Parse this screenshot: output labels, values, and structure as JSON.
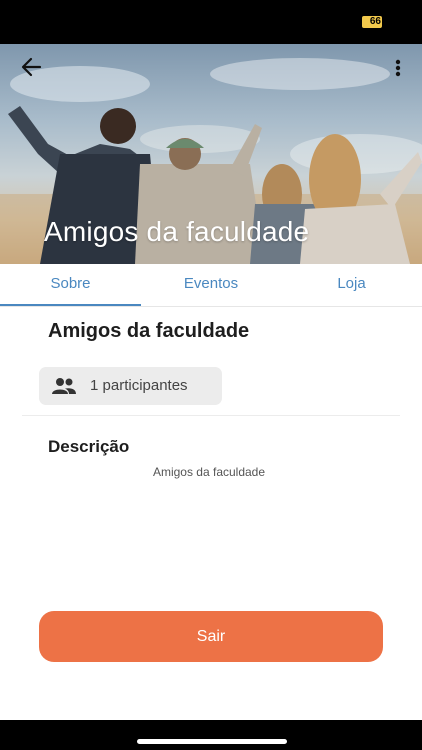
{
  "status_bar": {
    "battery_level": "66"
  },
  "header": {
    "title": "Amigos da faculdade",
    "back_icon": "arrow-left-icon",
    "menu_icon": "more-vertical-icon"
  },
  "tabs": [
    {
      "label": "Sobre",
      "active": true
    },
    {
      "label": "Eventos",
      "active": false
    },
    {
      "label": "Loja",
      "active": false
    }
  ],
  "group": {
    "name": "Amigos da faculdade",
    "participants_label": "1 participantes",
    "participants_icon": "people-icon"
  },
  "description": {
    "title": "Descrição",
    "text": "Amigos da faculdade"
  },
  "actions": {
    "exit_label": "Sair"
  },
  "colors": {
    "accent": "#4a88c0",
    "exit_button": "#ed7246",
    "chip_bg": "#ececec"
  }
}
